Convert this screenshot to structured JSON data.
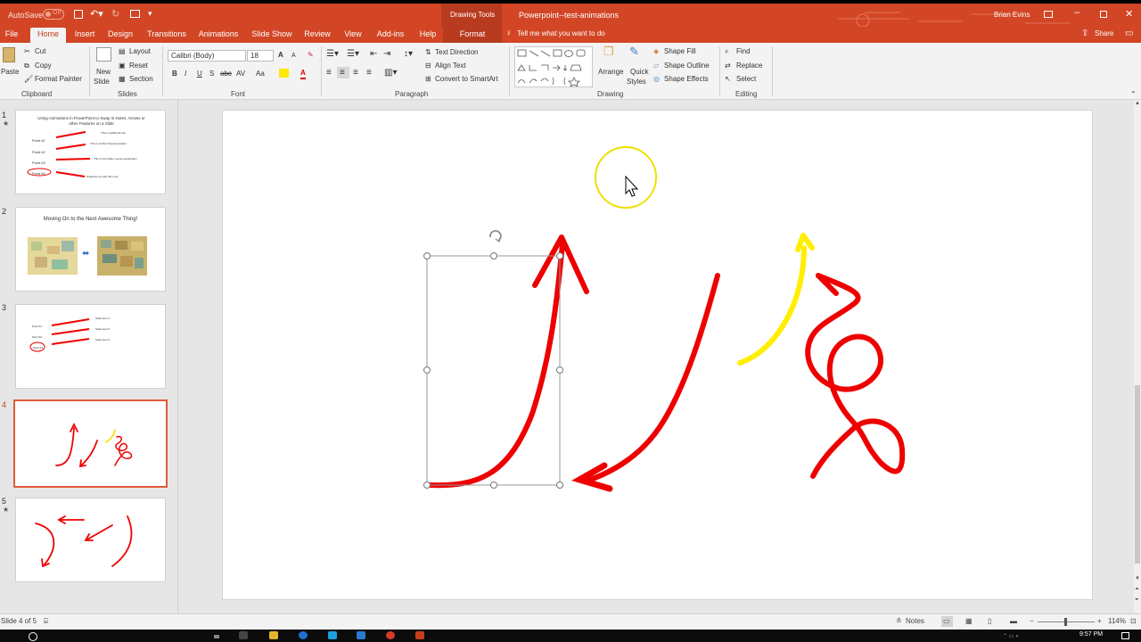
{
  "window": {
    "autosave_label": "AutoSave",
    "autosave_state": "Off",
    "context_label": "Drawing Tools",
    "doc_title": "Powerpoint--test-animations",
    "user_name": "Brian Evins",
    "share_label": "Share"
  },
  "tabs": [
    {
      "label": "File"
    },
    {
      "label": "Home"
    },
    {
      "label": "Insert"
    },
    {
      "label": "Design"
    },
    {
      "label": "Transitions"
    },
    {
      "label": "Animations"
    },
    {
      "label": "Slide Show"
    },
    {
      "label": "Review"
    },
    {
      "label": "View"
    },
    {
      "label": "Add-ins"
    },
    {
      "label": "Help"
    },
    {
      "label": "Format"
    }
  ],
  "tell_me": "Tell me what you want to do",
  "ribbon": {
    "clipboard": {
      "paste": "Paste",
      "cut": "Cut",
      "copy": "Copy",
      "format_painter": "Format Painter",
      "group": "Clipboard"
    },
    "slides": {
      "new_slide_1": "New",
      "new_slide_2": "Slide",
      "layout": "Layout",
      "reset": "Reset",
      "section": "Section",
      "group": "Slides"
    },
    "font": {
      "name": "Calibri (Body)",
      "size": "18",
      "group": "Font",
      "bold": "B",
      "italic": "I",
      "underline": "U",
      "shadow": "S",
      "strike": "abc",
      "spacing": "AV",
      "case": "Aa",
      "grow": "A",
      "shrink": "A",
      "color": "A"
    },
    "paragraph": {
      "text_direction": "Text Direction",
      "align_text": "Align Text",
      "convert": "Convert to SmartArt",
      "group": "Paragraph"
    },
    "drawing": {
      "arrange": "Arrange",
      "quick_styles_1": "Quick",
      "quick_styles_2": "Styles",
      "shape_fill": "Shape Fill",
      "shape_outline": "Shape Outline",
      "shape_effects": "Shape Effects",
      "group": "Drawing"
    },
    "editing": {
      "find": "Find",
      "replace": "Replace",
      "select": "Select",
      "group": "Editing"
    }
  },
  "thumbnails": [
    {
      "num": "1",
      "starred": true,
      "title": "Using Animations in PowerPoint to Swap in Notes, Arrows or other Features on a Slide",
      "points": [
        "Point #1",
        "Point #2",
        "Point #3",
        "Point #4"
      ],
      "notes": [
        "This is additional info",
        "This is another Representation",
        "This is the hidden secret explanation",
        "Wrapping up with this note"
      ]
    },
    {
      "num": "2",
      "starred": false,
      "title": "Moving On to the Next Awesome Thing!"
    },
    {
      "num": "3",
      "starred": false,
      "points": [
        "Point #1",
        "Point #2",
        "Point #3"
      ],
      "notes": [
        "Statement 1",
        "Statement 2",
        "Statement 3"
      ]
    },
    {
      "num": "4",
      "starred": false,
      "selected": true
    },
    {
      "num": "5",
      "starred": true
    }
  ],
  "status": {
    "slide_info": "Slide 4 of 5",
    "notes": "Notes",
    "zoom_minus": "−",
    "zoom_plus": "+",
    "zoom": "114%"
  },
  "taskbar": {
    "time": "9:57 PM"
  },
  "colors": {
    "accent": "#d24625",
    "arrow_red": "#ee0000",
    "arrow_yellow": "#ffee00",
    "cursor_ring": "#eee000"
  }
}
